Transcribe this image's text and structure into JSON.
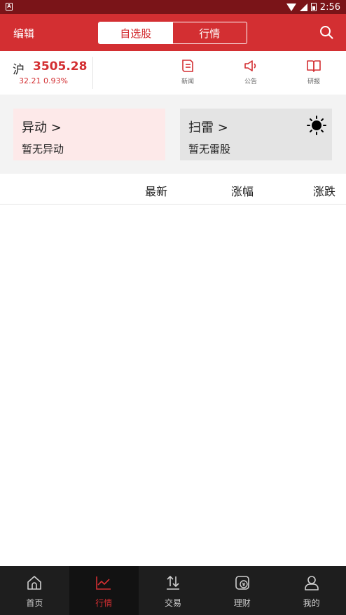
{
  "status_bar": {
    "time": "2:56"
  },
  "header": {
    "edit_label": "编辑",
    "tabs": [
      {
        "label": "自选股",
        "active": true
      },
      {
        "label": "行情",
        "active": false
      }
    ],
    "search_icon": "search-icon"
  },
  "index": {
    "name": "沪",
    "value": "3505.28",
    "change": "32.21  0.93%",
    "quick_links": [
      {
        "label": "新闻",
        "icon": "news-icon"
      },
      {
        "label": "公告",
        "icon": "announcement-icon"
      },
      {
        "label": "研报",
        "icon": "research-report-icon"
      }
    ]
  },
  "cards": {
    "alert": {
      "title": "异动 >",
      "subtitle": "暂无异动"
    },
    "mine": {
      "title": "扫雷 >",
      "subtitle": "暂无雷股",
      "icon": "sun-icon"
    }
  },
  "table": {
    "headers": [
      "最新",
      "涨幅",
      "涨跌"
    ]
  },
  "bottom_nav": [
    {
      "label": "首页",
      "icon": "home-icon",
      "active": false
    },
    {
      "label": "行情",
      "icon": "chart-icon",
      "active": true
    },
    {
      "label": "交易",
      "icon": "trade-icon",
      "active": false
    },
    {
      "label": "理财",
      "icon": "wealth-icon",
      "active": false
    },
    {
      "label": "我的",
      "icon": "profile-icon",
      "active": false
    }
  ],
  "colors": {
    "accent": "#d32f32",
    "status_bar": "#7a1418",
    "nav_background": "#1e1e1e"
  }
}
